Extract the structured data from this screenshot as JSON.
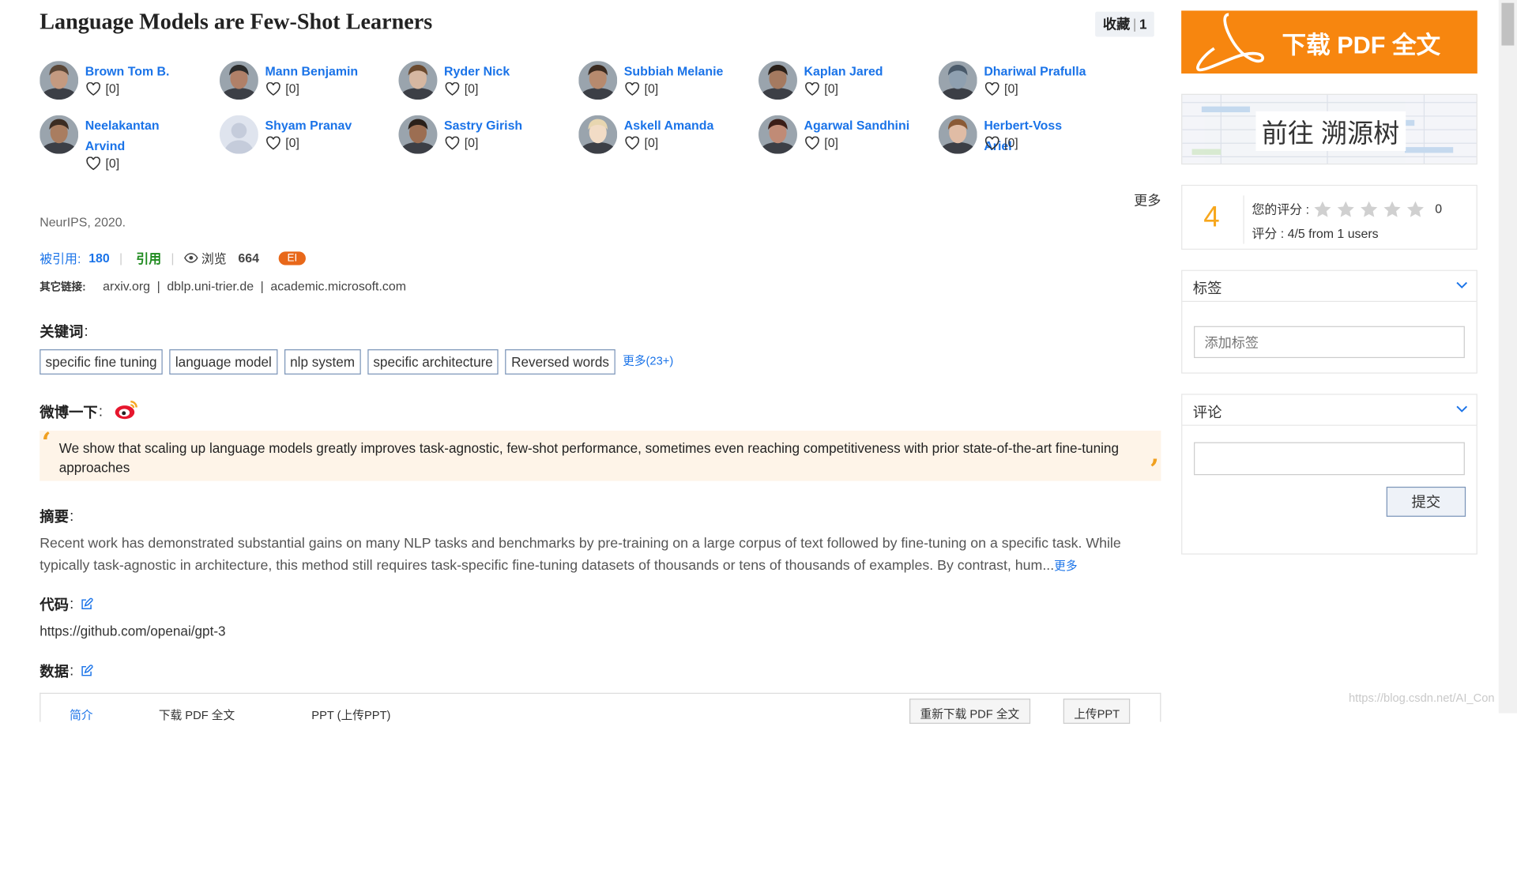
{
  "paper": {
    "title": "Language Models are Few-Shot Learners",
    "favorite_label": "收藏",
    "favorite_count": "1",
    "venue": "NeurIPS, 2020."
  },
  "authors": [
    {
      "name": "Brown Tom B.",
      "likes": "[0]"
    },
    {
      "name": "Mann Benjamin",
      "likes": "[0]"
    },
    {
      "name": "Ryder Nick",
      "likes": "[0]"
    },
    {
      "name": "Subbiah Melanie",
      "likes": "[0]"
    },
    {
      "name": "Kaplan Jared",
      "likes": "[0]"
    },
    {
      "name": "Dhariwal Prafulla",
      "likes": "[0]"
    },
    {
      "name": "Neelakantan Arvind",
      "likes": "[0]"
    },
    {
      "name": "Shyam Pranav",
      "likes": "[0]"
    },
    {
      "name": "Sastry Girish",
      "likes": "[0]"
    },
    {
      "name": "Askell Amanda",
      "likes": "[0]"
    },
    {
      "name": "Agarwal Sandhini",
      "likes": "[0]"
    },
    {
      "name": "Herbert-Voss Ariel",
      "likes": "[0]"
    }
  ],
  "authors_more": "更多",
  "stats": {
    "cited_label": "被引用:",
    "cited_count": "180",
    "cite_label": "引用",
    "views_label": "浏览",
    "views_count": "664",
    "badge": "EI"
  },
  "other_links": {
    "label": "其它链接:",
    "items": [
      "arxiv.org",
      "dblp.uni-trier.de",
      "academic.microsoft.com"
    ]
  },
  "keywords": {
    "heading": "关键词",
    "items": [
      "specific fine tuning",
      "language model",
      "nlp system",
      "specific architecture",
      "Reversed words"
    ],
    "more": "更多(23+)"
  },
  "weibo": {
    "heading": "微博一下",
    "quote": "We show that scaling up language models greatly improves task-agnostic, few-shot performance, sometimes even reaching competitiveness with prior state-of-the-art fine-tuning approaches"
  },
  "abstract": {
    "heading": "摘要",
    "text": "Recent work has demonstrated substantial gains on many NLP tasks and benchmarks by pre-training on a large corpus of text followed by fine-tuning on a specific task. While typically task-agnostic in architecture, this method still requires task-specific fine-tuning datasets of thousands or tens of thousands of examples. By contrast, hum...",
    "more": "更多"
  },
  "code": {
    "heading": "代码",
    "url": "https://github.com/openai/gpt-3"
  },
  "data_section": {
    "heading": "数据"
  },
  "bottom_bar": {
    "item1": "简介",
    "item2": "下载 PDF 全文",
    "item3": "PPT (上传PPT)",
    "btn1": "重新下载 PDF 全文",
    "btn2": "上传PPT"
  },
  "sidebar": {
    "pdf_button": "下载 PDF 全文",
    "tree_button": "前往 溯源树",
    "rating": {
      "score": "4",
      "your_rating_label": "您的评分 :",
      "your_rating_value": "0",
      "summary": "评分 : 4/5 from 1 users",
      "stars_filled": 0,
      "stars_total": 5
    },
    "tags": {
      "title": "标签",
      "placeholder": "添加标签"
    },
    "comments": {
      "title": "评论",
      "submit": "提交"
    }
  },
  "watermark": "https://blog.csdn.net/AI_Con",
  "colors": {
    "accent_blue": "#1a73e8",
    "pdf_orange": "#f7860f",
    "rating_orange": "#f7a71d",
    "ei_badge": "#e8681a",
    "quote_bg": "#fef4e8"
  }
}
